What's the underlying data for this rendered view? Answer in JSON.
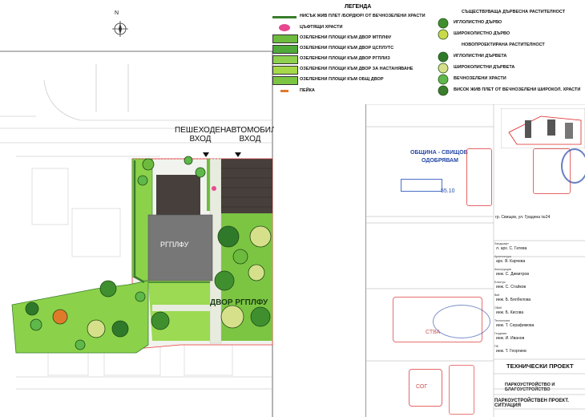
{
  "north_label": "N",
  "plan": {
    "entrance_pedestrian": [
      "ПЕШЕХОДЕН",
      "ВХОД"
    ],
    "entrance_car": [
      "АВТОМОБИЛ",
      "ВХОД"
    ],
    "building_label": "РГПЛФУ",
    "yard_label": "ДВОР РГПЛФУ"
  },
  "legend": {
    "title": "ЛЕГЕНДА",
    "left_items": [
      {
        "label": "НИСЪК ЖИВ ПЛЕТ /БОРДЮР/ ОТ ВЕЧНОЗЕЛЕНИ ХРАСТИ",
        "color": "#3a7d2c"
      },
      {
        "label": "ЦЪФТЯЩИ ХРАСТИ",
        "color": "#e8468f"
      },
      {
        "label": "ОЗЕЛЕНЕНИ ПЛОЩИ КЪМ ДВОР МТПЛФУ",
        "color": "#6dbb3e"
      },
      {
        "label": "ОЗЕЛЕНЕНИ ПЛОЩИ КЪМ ДВОР ЦСПЛУТС",
        "color": "#4faa3a"
      },
      {
        "label": "ОЗЕЛЕНЕНИ ПЛОЩИ КЪМ ДВОР РГПЛИЗ",
        "color": "#8fd14f"
      },
      {
        "label": "ОЗЕЛЕНЕНИ ПЛОЩИ КЪМ ДВОР ЗА НАСТАНЯВАНЕ",
        "color": "#a5d94a"
      },
      {
        "label": "ОЗЕЛЕНЕНИ ПЛОЩИ КЪМ ОБЩ ДВОР",
        "color": "#7cc543"
      },
      {
        "label": "ПЕЙКА",
        "color": "#e07a2b"
      }
    ],
    "right_items": [
      {
        "label": "СЪЩЕСТВУВАЩА ДЪРВЕСНА РАСТИТЕЛНОСТ",
        "heading": true
      },
      {
        "label": "ИГЛОЛИСТНО ДЪРВО",
        "heading": false
      },
      {
        "label": "ШИРОКОЛИСТНО ДЪРВО",
        "heading": false
      },
      {
        "label": "НОВОПРОЕКТИРАНА РАСТИТЕЛНОСТ",
        "heading": true
      },
      {
        "label": "ИГЛОЛИСТНИ ДЪРВЕТА",
        "heading": false
      },
      {
        "label": "ШИРОКОЛИСТНИ ДЪРВЕТА",
        "heading": false
      },
      {
        "label": "ВЕЧНОЗЕЛЕНИ ХРАСТИ",
        "heading": false
      },
      {
        "label": "ВИСОК ЖИВ ПЛЕТ ОТ ВЕЧНОЗЕЛЕНИ ШИРОКОЛ. ХРАСТИ",
        "heading": false
      }
    ]
  },
  "title_block": {
    "stamp_line1": "ОБЩИНА - СВИЩОВ",
    "stamp_line2": "ОДОБРЯВАМ",
    "stamp_line3": "55.10",
    "address": "гр. Свищов, ул. Градина №24",
    "people": [
      {
        "role": "Ландшафт",
        "name": "л. арх. С. Гатева"
      },
      {
        "role": "Архитектура",
        "name": "арх. Я. Карчева"
      },
      {
        "role": "Конструкции",
        "name": "инж. С. Димитров"
      },
      {
        "role": "Електро",
        "name": "инж. С. Стайков"
      },
      {
        "role": "ВиК",
        "name": "инж. Б. Бялбелова"
      },
      {
        "role": "ОВиК",
        "name": "инж. Б. Кисова"
      },
      {
        "role": "Технология",
        "name": "инж. Т. Серафимова"
      },
      {
        "role": "Геодезия",
        "name": "инж. И. Иванов"
      },
      {
        "role": "ПБ",
        "name": "инж. Т. Георгиев"
      }
    ],
    "phase_heading": "ТЕХНИЧЕСКИ ПРОЕКТ",
    "part_label": "ПАРКОУСТРОЙСТВО И БЛАГОУСТРОЙСТВО",
    "drawing_title": "ПАРКОУСТРОЙСТВЕН ПРОЕКТ. СИТУАЦИЯ",
    "bottom_stamp": "СОГ",
    "mid_stamp": "СТВА"
  }
}
